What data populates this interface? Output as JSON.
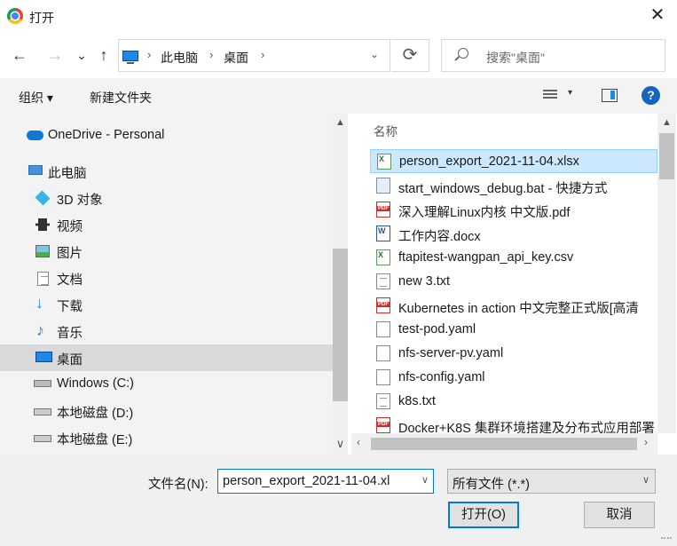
{
  "window": {
    "title": "打开",
    "close_glyph": "✕"
  },
  "navigation": {
    "back": "←",
    "forward": "→",
    "recent": "⌄",
    "up": "↑",
    "breadcrumb": [
      "此电脑",
      "桌面"
    ],
    "separator": "›",
    "dropdown": "⌄",
    "refresh": "⟳",
    "search_placeholder": "搜索\"桌面\""
  },
  "toolbar": {
    "organize": "组织 ▾",
    "new_folder": "新建文件夹",
    "view_dropdown": "▾",
    "help": "?"
  },
  "sidebar": {
    "items": [
      {
        "label": "OneDrive - Personal",
        "icon": "cloud-icon"
      },
      {
        "label": "此电脑",
        "icon": "computer-icon"
      },
      {
        "label": "3D 对象",
        "icon": "cube-3d-icon"
      },
      {
        "label": "视频",
        "icon": "video-icon"
      },
      {
        "label": "图片",
        "icon": "picture-icon"
      },
      {
        "label": "文档",
        "icon": "document-icon"
      },
      {
        "label": "下载",
        "icon": "download-icon"
      },
      {
        "label": "音乐",
        "icon": "music-icon"
      },
      {
        "label": "桌面",
        "icon": "desktop-icon",
        "selected": true
      },
      {
        "label": "Windows (C:)",
        "icon": "windows-drive-icon"
      },
      {
        "label": "本地磁盘 (D:)",
        "icon": "drive-icon"
      },
      {
        "label": "本地磁盘 (E:)",
        "icon": "drive-icon"
      }
    ],
    "scroll_up": "▲",
    "scroll_down": "∨"
  },
  "files": {
    "column_header": "名称",
    "items": [
      {
        "name": "person_export_2021-11-04.xlsx",
        "type": "xlsx",
        "selected": true
      },
      {
        "name": "start_windows_debug.bat - 快捷方式",
        "type": "bat"
      },
      {
        "name": "深入理解Linux内核 中文版.pdf",
        "type": "pdf"
      },
      {
        "name": "工作内容.docx",
        "type": "docx"
      },
      {
        "name": "ftapitest-wangpan_api_key.csv",
        "type": "xlsx"
      },
      {
        "name": "new 3.txt",
        "type": "txt"
      },
      {
        "name": "Kubernetes in action 中文完整正式版[高清",
        "type": "pdf"
      },
      {
        "name": "test-pod.yaml",
        "type": "blank"
      },
      {
        "name": "nfs-server-pv.yaml",
        "type": "blank"
      },
      {
        "name": "nfs-config.yaml",
        "type": "blank"
      },
      {
        "name": "k8s.txt",
        "type": "txt"
      },
      {
        "name": "Docker+K8S 集群环境搭建及分布式应用部署",
        "type": "pdf"
      }
    ],
    "scroll_left": "‹",
    "scroll_right": "›",
    "scroll_up": "▲",
    "scroll_down": "▼"
  },
  "footer": {
    "filename_label": "文件名(N):",
    "filename_value": "person_export_2021-11-04.xl",
    "filetype_value": "所有文件 (*.*)",
    "dropdown": "∨",
    "open_label": "打开(O)",
    "cancel_label": "取消"
  }
}
